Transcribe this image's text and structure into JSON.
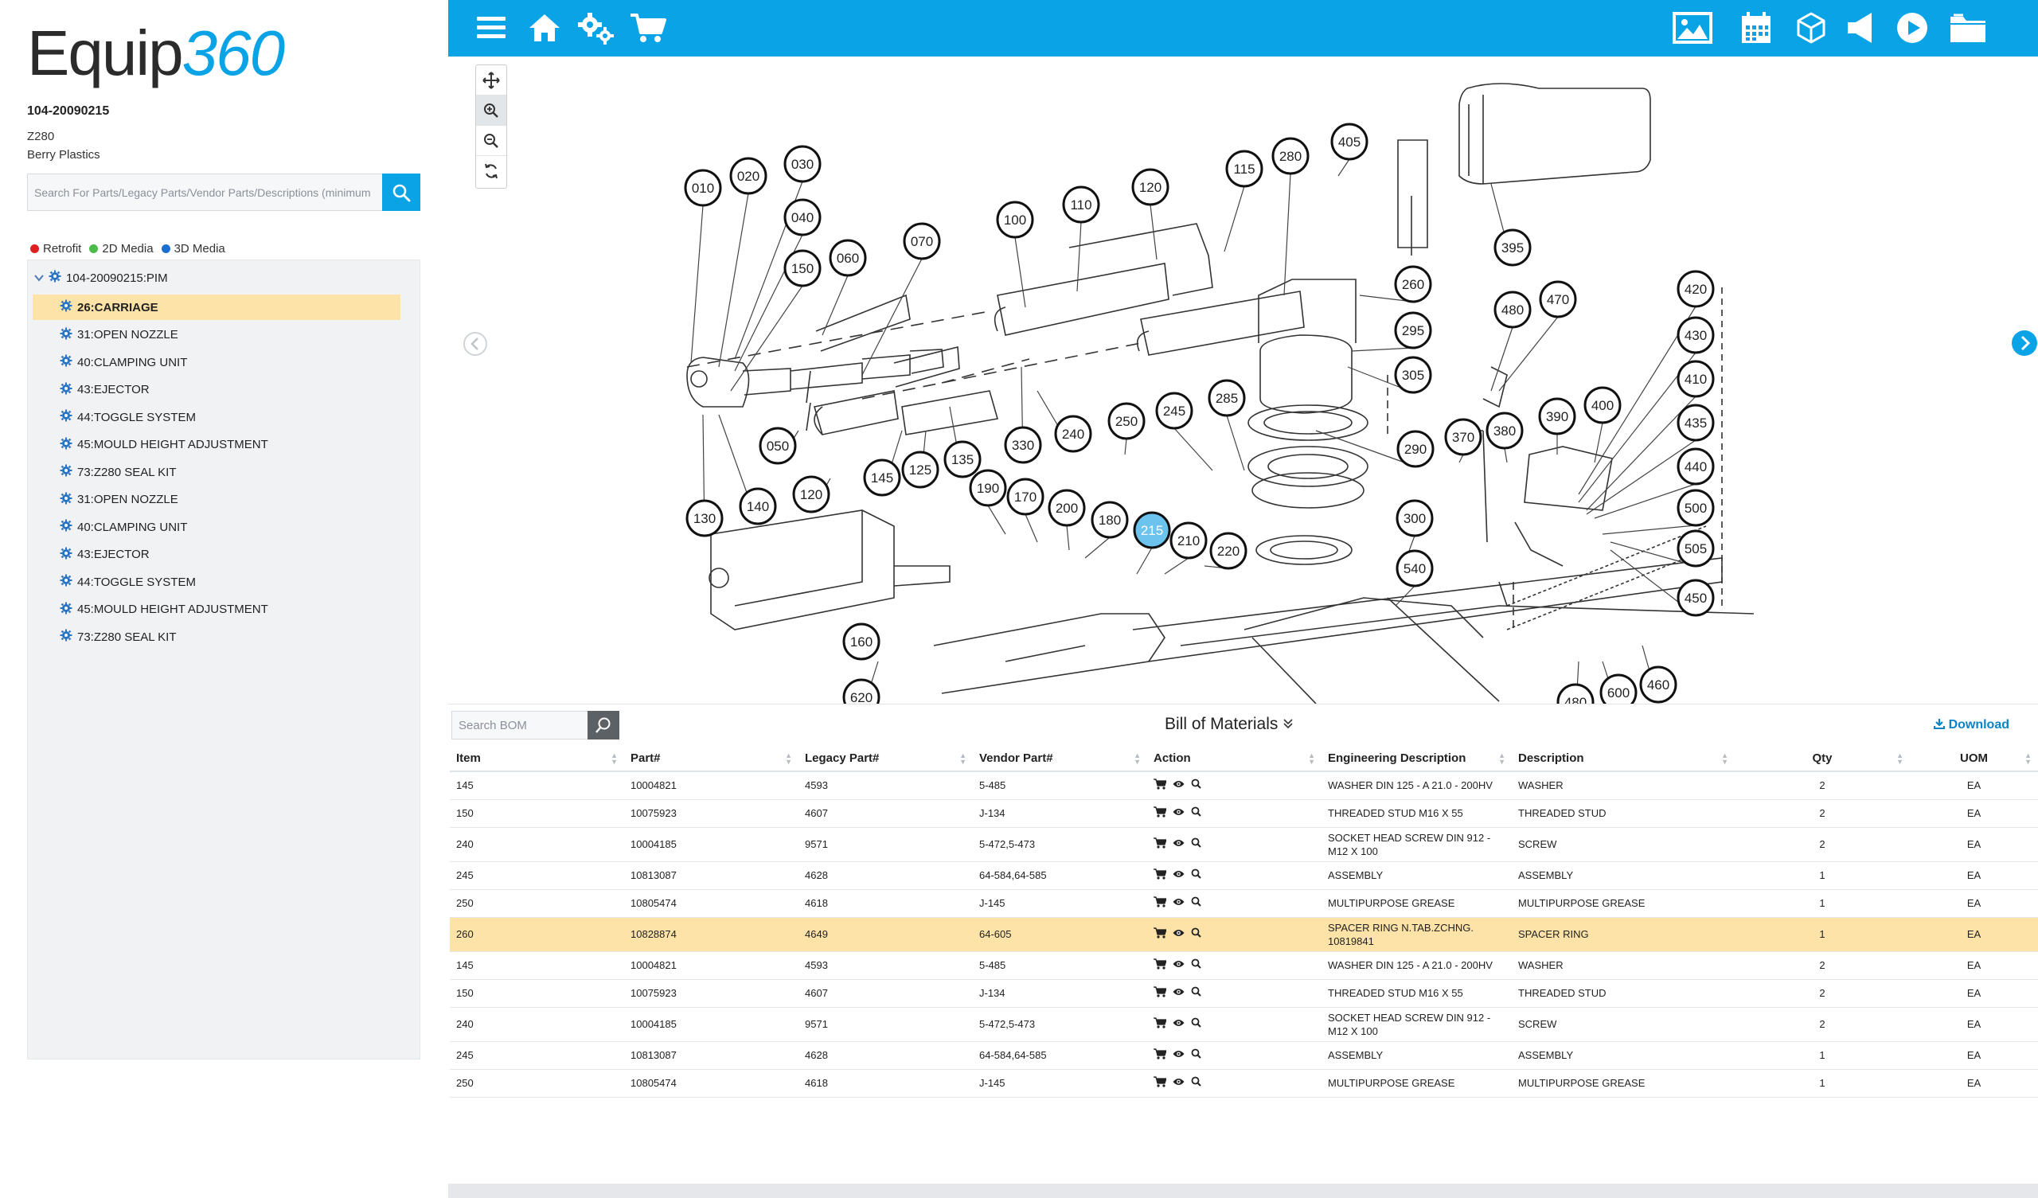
{
  "brand": {
    "part1": "Equip",
    "part2": "360"
  },
  "machine": {
    "id": "104-20090215",
    "model": "Z280",
    "customer": "Berry Plastics"
  },
  "search": {
    "placeholder": "Search For Parts/Legacy Parts/Vendor Parts/Descriptions (minimum"
  },
  "legend": [
    {
      "label": "Retrofit",
      "color": "#e02020"
    },
    {
      "label": "2D Media",
      "color": "#4cbb4c"
    },
    {
      "label": "3D Media",
      "color": "#1b6fd0"
    }
  ],
  "tree": {
    "root": "104-20090215:PIM",
    "items": [
      "26:CARRIAGE",
      "31:OPEN NOZZLE",
      "40:CLAMPING UNIT",
      "43:EJECTOR",
      "44:TOGGLE SYSTEM",
      "45:MOULD HEIGHT ADJUSTMENT",
      "73:Z280 SEAL KIT",
      "31:OPEN NOZZLE",
      "40:CLAMPING UNIT",
      "43:EJECTOR",
      "44:TOGGLE SYSTEM",
      "45:MOULD HEIGHT ADJUSTMENT",
      "73:Z280 SEAL KIT"
    ],
    "selected_index": 0
  },
  "topbar": {
    "left_icons": [
      "menu-icon",
      "home-icon",
      "settings-gears-icon",
      "cart-icon"
    ],
    "right_icons": [
      "image-icon",
      "calendar-icon",
      "cube-3d-icon",
      "speaker-icon",
      "play-icon",
      "folder-icon"
    ]
  },
  "diagram": {
    "balloons": [
      "010",
      "020",
      "030",
      "040",
      "150",
      "060",
      "070",
      "100",
      "110",
      "120",
      "115",
      "280",
      "405",
      "395",
      "260",
      "295",
      "305",
      "480",
      "470",
      "420",
      "430",
      "410",
      "435",
      "440",
      "500",
      "505",
      "450",
      "050",
      "145",
      "125",
      "135",
      "330",
      "240",
      "250",
      "245",
      "285",
      "290",
      "370",
      "380",
      "390",
      "400",
      "190",
      "170",
      "200",
      "180",
      "215",
      "210",
      "220",
      "300",
      "540",
      "130",
      "140",
      "120",
      "160",
      "620",
      "600",
      "460",
      "480"
    ],
    "highlighted": "215"
  },
  "bom": {
    "search_placeholder": "Search BOM",
    "title": "Bill of Materials",
    "download": "Download",
    "columns": [
      "Item",
      "Part#",
      "Legacy Part#",
      "Vendor Part#",
      "Action",
      "Engineering Description",
      "Description",
      "Qty",
      "UOM"
    ],
    "rows": [
      {
        "item": "145",
        "part": "10004821",
        "legacy": "4593",
        "vendor": "5-485",
        "eng": "WASHER DIN 125 - A 21.0 - 200HV",
        "desc": "WASHER",
        "qty": "2",
        "uom": "EA"
      },
      {
        "item": "150",
        "part": "10075923",
        "legacy": "4607",
        "vendor": "J-134",
        "eng": "THREADED STUD M16 X 55",
        "desc": "THREADED STUD",
        "qty": "2",
        "uom": "EA"
      },
      {
        "item": "240",
        "part": "10004185",
        "legacy": "9571",
        "vendor": "5-472,5-473",
        "eng": "SOCKET HEAD SCREW DIN 912 - M12 X 100",
        "desc": "SCREW",
        "qty": "2",
        "uom": "EA"
      },
      {
        "item": "245",
        "part": "10813087",
        "legacy": "4628",
        "vendor": "64-584,64-585",
        "eng": "ASSEMBLY",
        "desc": "ASSEMBLY",
        "qty": "1",
        "uom": "EA"
      },
      {
        "item": "250",
        "part": "10805474",
        "legacy": "4618",
        "vendor": "J-145",
        "eng": "MULTIPURPOSE GREASE",
        "desc": "MULTIPURPOSE GREASE",
        "qty": "1",
        "uom": "EA"
      },
      {
        "item": "260",
        "part": "10828874",
        "legacy": "4649",
        "vendor": "64-605",
        "eng": "SPACER RING N.TAB.ZCHNG. 10819841",
        "desc": "SPACER RING",
        "qty": "1",
        "uom": "EA"
      },
      {
        "item": "145",
        "part": "10004821",
        "legacy": "4593",
        "vendor": "5-485",
        "eng": "WASHER DIN 125 - A 21.0 - 200HV",
        "desc": "WASHER",
        "qty": "2",
        "uom": "EA"
      },
      {
        "item": "150",
        "part": "10075923",
        "legacy": "4607",
        "vendor": "J-134",
        "eng": "THREADED STUD M16 X 55",
        "desc": "THREADED STUD",
        "qty": "2",
        "uom": "EA"
      },
      {
        "item": "240",
        "part": "10004185",
        "legacy": "9571",
        "vendor": "5-472,5-473",
        "eng": "SOCKET HEAD SCREW DIN 912 - M12 X 100",
        "desc": "SCREW",
        "qty": "2",
        "uom": "EA"
      },
      {
        "item": "245",
        "part": "10813087",
        "legacy": "4628",
        "vendor": "64-584,64-585",
        "eng": "ASSEMBLY",
        "desc": "ASSEMBLY",
        "qty": "1",
        "uom": "EA"
      },
      {
        "item": "250",
        "part": "10805474",
        "legacy": "4618",
        "vendor": "J-145",
        "eng": "MULTIPURPOSE GREASE",
        "desc": "MULTIPURPOSE GREASE",
        "qty": "1",
        "uom": "EA"
      }
    ],
    "highlight_row": 5
  }
}
